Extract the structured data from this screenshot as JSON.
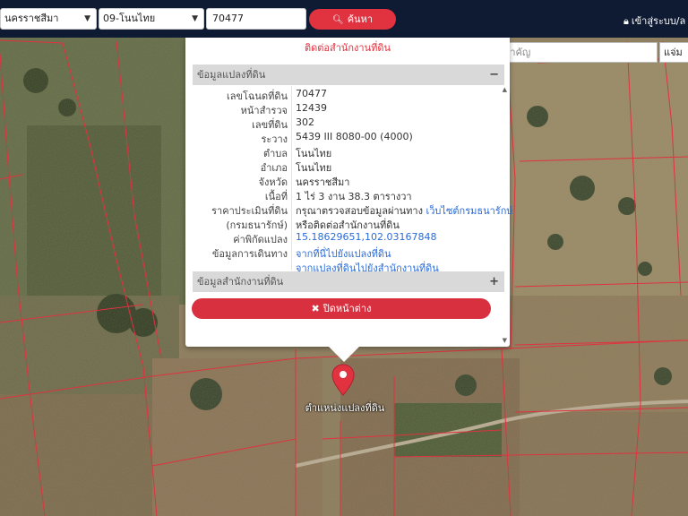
{
  "colors": {
    "nav_bg": "#0f1b33",
    "accent_red": "#e0323f",
    "link_blue": "#2a6bd8",
    "parcel_lines": "#e0323f"
  },
  "header": {
    "province_value": "นครราชสีมา",
    "district_value": "09-โนนไทย",
    "deed_number_value": "70477",
    "search_label": "ค้นหา",
    "search_icon": "search-icon",
    "login_label": "เข้าสู่ระบบ/ล",
    "login_icon": "lock-icon"
  },
  "place_search": {
    "placeholder": "ค้นหาสถานที่สำคัญ",
    "button_label": "แจ่ม"
  },
  "popup": {
    "contact_text": "ติดต่อสำนักงานที่ดิน",
    "land_section_title": "ข้อมูลแปลงที่ดิน",
    "land_section_toggle": "−",
    "office_section_title": "ข้อมูลสำนักงานที่ดิน",
    "office_section_toggle": "+",
    "close_label": "ปิดหน้าต่าง",
    "close_icon": "close-icon",
    "rows": [
      {
        "label": "เลขโฉนดที่ดิน",
        "value": "70477"
      },
      {
        "label": "หน้าสำรวจ",
        "value": "12439"
      },
      {
        "label": "เลขที่ดิน",
        "value": "302"
      },
      {
        "label": "ระวาง",
        "value": "5439 III 8080-00 (4000)"
      },
      {
        "label": "ตำบล",
        "value": "โนนไทย"
      },
      {
        "label": "อำเภอ",
        "value": "โนนไทย"
      },
      {
        "label": "จังหวัด",
        "value": "นครราชสีมา"
      },
      {
        "label": "เนื้อที่",
        "value": "1 ไร่ 3 งาน 38.3 ตารางวา"
      }
    ],
    "price_label_1": "ราคาประเมินที่ดิน",
    "price_label_2": "(กรมธนารักษ์)",
    "price_text_1": "กรุณาตรวจสอบข้อมูลผ่านทาง",
    "price_link": "เว็บไซต์กรมธนารักษ์",
    "price_text_2": "หรือติดต่อสำนักงานที่ดิน",
    "coord_label": "ค่าพิกัดแปลง",
    "coord_value": "15.18629651,102.03167848",
    "travel_label": "ข้อมูลการเดินทาง",
    "travel_link_1": "จากที่นี่ไปยังแปลงที่ดิน",
    "travel_link_2": "จากแปลงที่ดินไปยังสำนักงานที่ดิน"
  },
  "marker": {
    "label": "ตำแหน่งแปลงที่ดิน"
  }
}
